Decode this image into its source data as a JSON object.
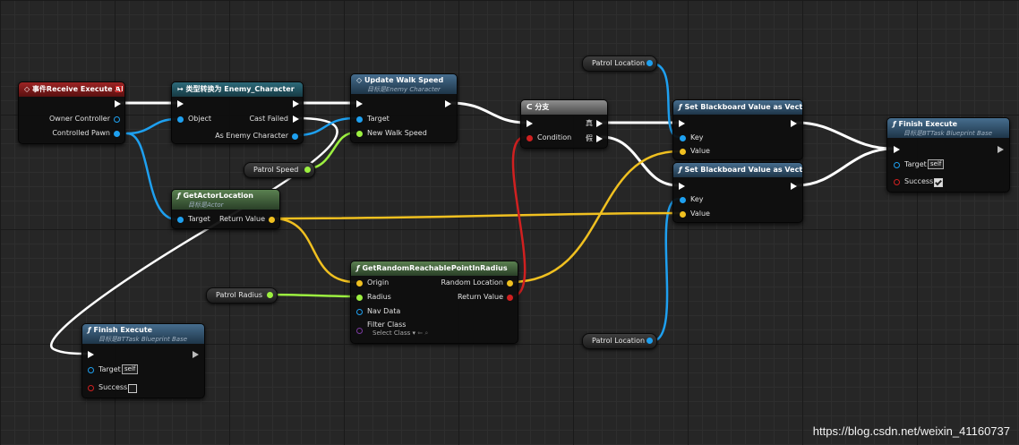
{
  "colors": {
    "exec": "#ffffff",
    "object": "#1ea0f0",
    "vector": "#f0c020",
    "float": "#9cf040",
    "bool": "#d02020",
    "class": "#7a3aa0"
  },
  "nodes": {
    "event": {
      "title": "事件Receive Execute AI",
      "owner": "Owner Controller",
      "pawn": "Controlled Pawn"
    },
    "cast": {
      "title": "类型转换为 Enemy_Character",
      "object": "Object",
      "failed": "Cast Failed",
      "as": "As Enemy Character"
    },
    "update": {
      "title": "Update Walk Speed",
      "subtitle": "目标是Enemy Character",
      "target": "Target",
      "speed": "New Walk Speed"
    },
    "branch": {
      "title": "分支",
      "cond": "Condition",
      "t": "真",
      "f": "假"
    },
    "setbb1": {
      "title": "Set Blackboard Value as Vector",
      "key": "Key",
      "value": "Value"
    },
    "setbb2": {
      "title": "Set Blackboard Value as Vector",
      "key": "Key",
      "value": "Value"
    },
    "finish_top": {
      "title": "Finish Execute",
      "subtitle": "目标是BTTask Blueprint Base",
      "target": "Target",
      "target_val": "self",
      "success": "Success"
    },
    "getloc": {
      "title": "GetActorLocation",
      "subtitle": "目标是Actor",
      "target": "Target",
      "ret": "Return Value"
    },
    "getrand": {
      "title": "GetRandomReachablePointInRadius",
      "origin": "Origin",
      "radius": "Radius",
      "nav": "Nav Data",
      "filter": "Filter Class",
      "filter_val": "Select Class",
      "rand": "Random Location",
      "ret": "Return Value"
    },
    "finish_bot": {
      "title": "Finish Execute",
      "subtitle": "目标是BTTask Blueprint Base",
      "target": "Target",
      "target_val": "self",
      "success": "Success"
    }
  },
  "vars": {
    "patrol_location_1": "Patrol Location",
    "patrol_speed": "Patrol Speed",
    "patrol_radius": "Patrol Radius",
    "patrol_location_2": "Patrol Location"
  },
  "icons": {
    "func": "ƒ"
  },
  "watermark": "https://blog.csdn.net/weixin_41160737"
}
